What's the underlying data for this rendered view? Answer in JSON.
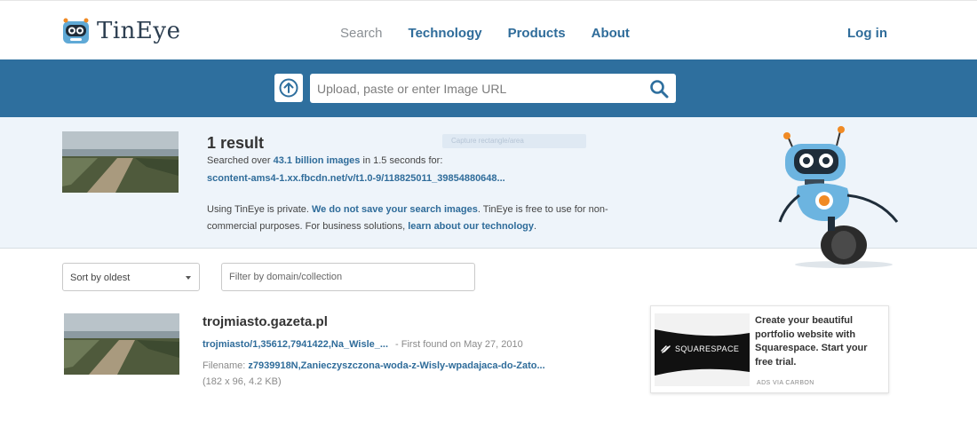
{
  "header": {
    "logo_text": "TinEye",
    "nav": [
      {
        "label": "Search",
        "active": true
      },
      {
        "label": "Technology",
        "active": false
      },
      {
        "label": "Products",
        "active": false
      },
      {
        "label": "About",
        "active": false
      }
    ],
    "login_label": "Log in"
  },
  "search": {
    "placeholder": "Upload, paste or enter Image URL",
    "upload_icon": "upload-arrow-icon",
    "search_icon": "magnifier-icon"
  },
  "summary": {
    "result_count": "1 result",
    "searched_prefix": "Searched over ",
    "searched_count": "43.1 billion images",
    "searched_suffix": " in 1.5 seconds for:",
    "query_url": "scontent-ams4-1.xx.fbcdn.net/v/t1.0-9/118825011_39854880648...",
    "privacy_1": "Using TinEye is private. ",
    "privacy_link_1": "We do not save your search images",
    "privacy_2": ". TinEye is free to use for non-commercial purposes. For business solutions, ",
    "privacy_link_2": "learn about our technology",
    "privacy_3": ".",
    "ghost_text": "Capture rectangle/area"
  },
  "controls": {
    "sort_label": "Sort by oldest",
    "filter_placeholder": "Filter by domain/collection"
  },
  "matches": [
    {
      "domain": "trojmiasto.gazeta.pl",
      "link": "trojmiasto/1,35612,7941422,Na_Wisle_...",
      "first_found": "- First found on May 27, 2010",
      "filename_label": "Filename: ",
      "filename": "z7939918N,Zanieczyszczona-woda-z-Wisly-wpadajaca-do-Zato...",
      "dims": "(182 x 96, 4.2 KB)"
    }
  ],
  "ad": {
    "brand": "SQUARESPACE",
    "text": "Create your beautiful portfolio website with Squarespace. Start your free trial.",
    "via": "ADS VIA CARBON"
  },
  "colors": {
    "brand_blue": "#2e6f9e",
    "link": "#2f6c9a",
    "summary_bg": "#eef4fa"
  }
}
